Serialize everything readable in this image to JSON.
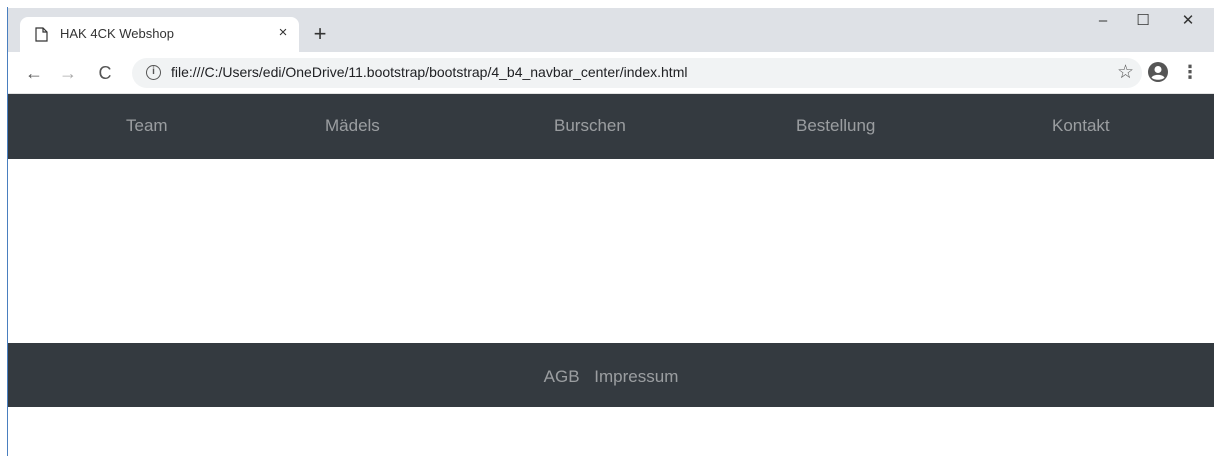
{
  "browser": {
    "tab_title": "HAK 4CK Webshop",
    "tab_close": "×",
    "new_tab": "+",
    "url": "file:///C:/Users/edi/OneDrive/11.bootstrap/bootstrap/4_b4_navbar_center/index.html",
    "window_controls": {
      "minimize": "–",
      "maximize": "☐",
      "close": "✕"
    },
    "nav": {
      "back": "←",
      "forward": "→",
      "reload": "C"
    },
    "icons": {
      "star": "☆",
      "menu": "⋮",
      "info": "i"
    }
  },
  "page": {
    "navbar": {
      "items": [
        {
          "label": "Team"
        },
        {
          "label": "Mädels"
        },
        {
          "label": "Burschen"
        },
        {
          "label": "Bestellung"
        },
        {
          "label": "Kontakt"
        }
      ]
    },
    "footer": {
      "links": [
        {
          "label": "AGB"
        },
        {
          "label": "Impressum"
        }
      ]
    }
  },
  "colors": {
    "navbar_bg": "#343a40",
    "tabstrip_bg": "#dee1e6",
    "omnibox_bg": "#f1f3f4"
  }
}
